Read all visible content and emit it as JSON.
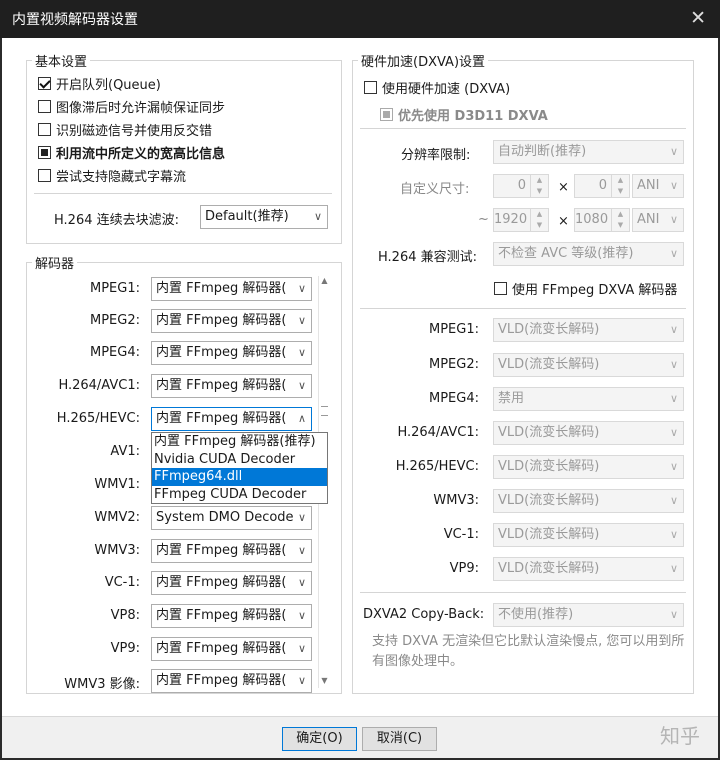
{
  "window": {
    "title": "内置视频解码器设置",
    "close_glyph": "✕"
  },
  "basic": {
    "title": "基本设置",
    "options": [
      {
        "label": "开启队列(Queue)",
        "checked": true
      },
      {
        "label": "图像滞后时允许漏帧保证同步",
        "checked": false
      },
      {
        "label": "识别磁迹信号并使用反交错",
        "checked": false
      },
      {
        "label": "利用流中所定义的宽高比信息",
        "checked": "indeterminate"
      },
      {
        "label": "尝试支持隐藏式字幕流",
        "checked": false
      }
    ],
    "deblock_label": "H.264 连续去块滤波:",
    "deblock_value": "Default(推荐)"
  },
  "decoders": {
    "title": "解码器",
    "rows": [
      {
        "label": "MPEG1:",
        "value": "内置 FFmpeg 解码器("
      },
      {
        "label": "MPEG2:",
        "value": "内置 FFmpeg 解码器("
      },
      {
        "label": "MPEG4:",
        "value": "内置 FFmpeg 解码器("
      },
      {
        "label": "H.264/AVC1:",
        "value": "内置 FFmpeg 解码器("
      },
      {
        "label": "H.265/HEVC:",
        "value": "内置 FFmpeg 解码器("
      },
      {
        "label": "AV1:",
        "value": ""
      },
      {
        "label": "WMV1:",
        "value": ""
      },
      {
        "label": "WMV2:",
        "value": "System DMO Decoder"
      },
      {
        "label": "WMV3:",
        "value": "内置 FFmpeg 解码器("
      },
      {
        "label": "VC-1:",
        "value": "内置 FFmpeg 解码器("
      },
      {
        "label": "VP8:",
        "value": "内置 FFmpeg 解码器("
      },
      {
        "label": "VP9:",
        "value": "内置 FFmpeg 解码器("
      },
      {
        "label": "WMV3 影像:",
        "value": "内置 FFmpeg 解码器("
      }
    ],
    "dropdown_options": [
      "内置 FFmpeg 解码器(推荐)",
      "Nvidia CUDA Decoder",
      "FFmpeg64.dll",
      "FFmpeg CUDA Decoder"
    ],
    "dropdown_selected_index": 2
  },
  "hw": {
    "title": "硬件加速(DXVA)设置",
    "use_hw": "使用硬件加速 (DXVA)",
    "prefer_d3d11": "优先使用 D3D11 DXVA",
    "resolution_label": "分辨率限制:",
    "resolution_value": "自动判断(推荐)",
    "custom_size_label": "自定义尺寸:",
    "min_w": "0",
    "min_h": "0",
    "min_unit": "ANI",
    "tilde": "~",
    "max_w": "1920",
    "max_h": "1080",
    "max_unit": "ANI",
    "times": "×",
    "compat_label": "H.264 兼容测试:",
    "compat_value": "不检查 AVC 等级(推荐)",
    "ffmpeg_dxva": "使用 FFmpeg DXVA 解码器",
    "modes": [
      {
        "label": "MPEG1:",
        "value": "VLD(流变长解码)"
      },
      {
        "label": "MPEG2:",
        "value": "VLD(流变长解码)"
      },
      {
        "label": "MPEG4:",
        "value": "禁用"
      },
      {
        "label": "H.264/AVC1:",
        "value": "VLD(流变长解码)"
      },
      {
        "label": "H.265/HEVC:",
        "value": "VLD(流变长解码)"
      },
      {
        "label": "WMV3:",
        "value": "VLD(流变长解码)"
      },
      {
        "label": "VC-1:",
        "value": "VLD(流变长解码)"
      },
      {
        "label": "VP9:",
        "value": "VLD(流变长解码)"
      }
    ],
    "copyback_label": "DXVA2 Copy-Back:",
    "copyback_value": "不使用(推荐)",
    "note": "支持 DXVA 无渲染但它比默认渲染慢点, 您可以用到所有图像处理中。"
  },
  "footer": {
    "ok": "确定(O)",
    "cancel": "取消(C)",
    "watermark": "知乎"
  }
}
